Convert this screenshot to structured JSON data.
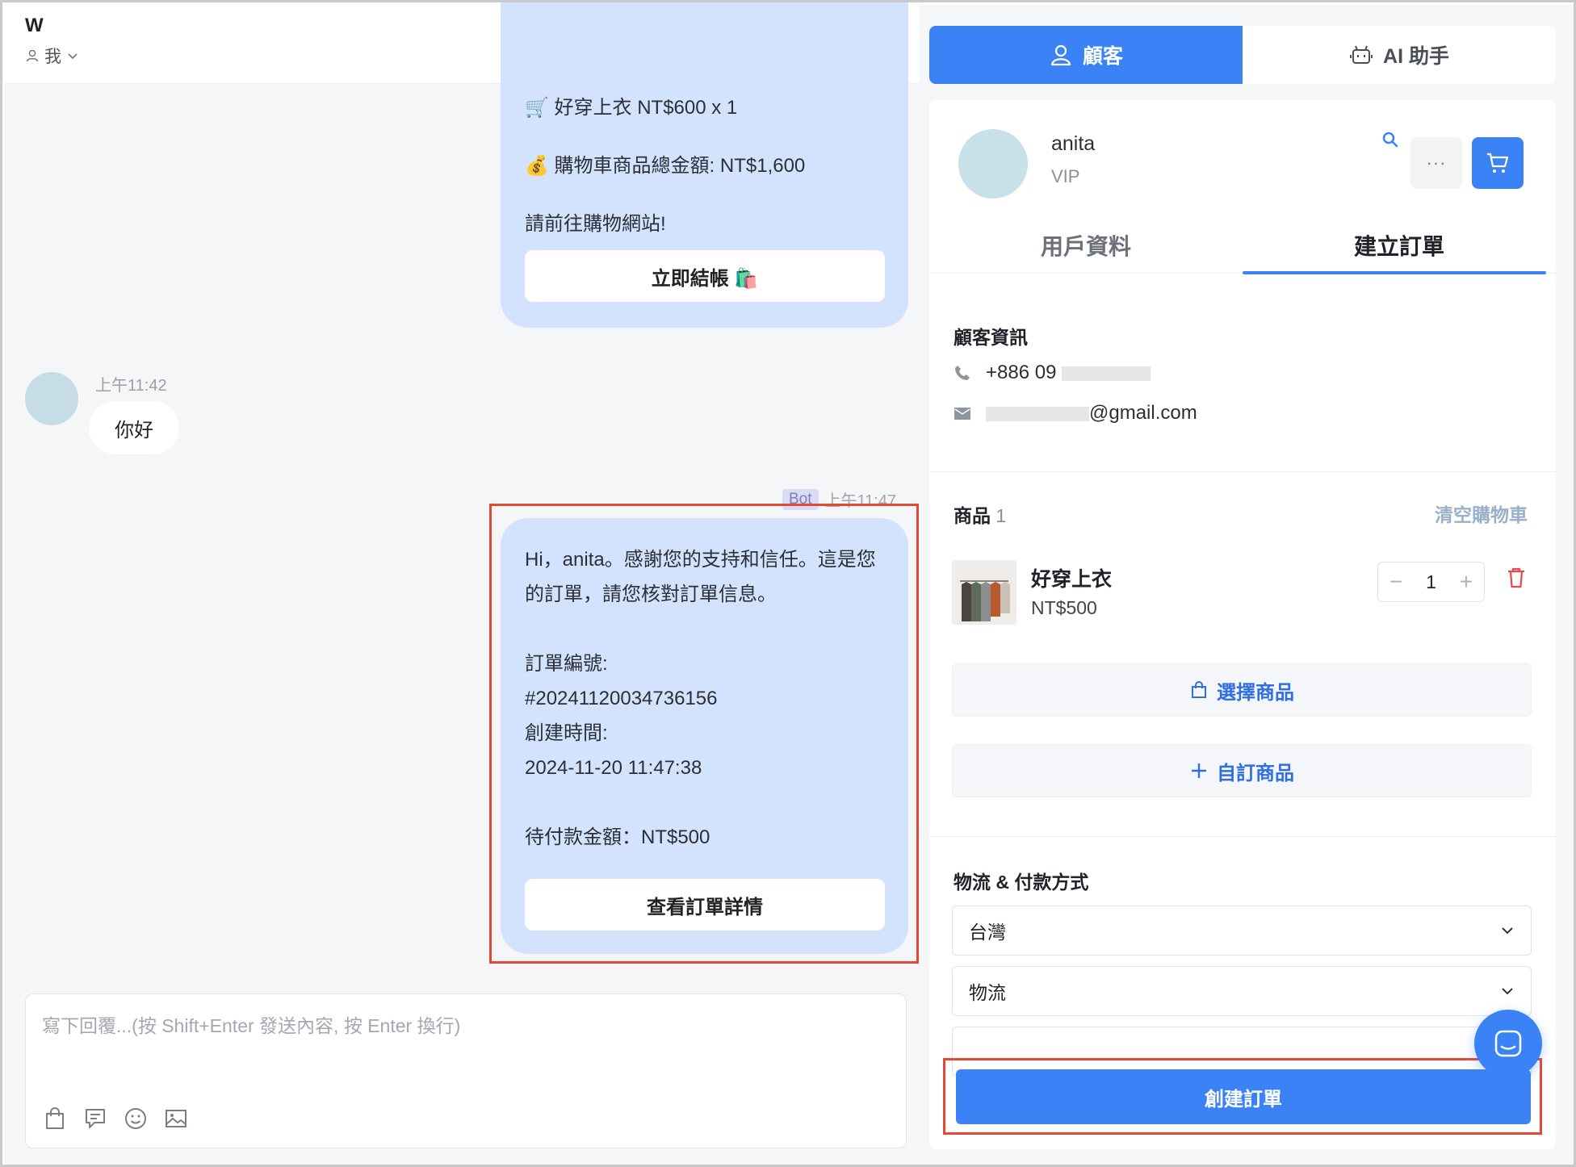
{
  "chat": {
    "title": "W",
    "agent": "我",
    "icons": [
      "star-icon",
      "message-square-icon",
      "clock-icon",
      "note-icon"
    ],
    "message1": {
      "lines": [
        "🛒 好穿上衣 NT$600 x 1",
        "💰 購物車商品總金額: NT$1,600",
        "請前往購物網站!"
      ],
      "button": "立即結帳 🛍️"
    },
    "user_message": {
      "time": "上午11:42",
      "text": "你好"
    },
    "bot_message": {
      "tag": "Bot",
      "time": "上午11:47",
      "text": "Hi，anita。感謝您的支持和信任。這是您的訂單，請您核對訂單信息。\n\n訂單編號:\n#20241120034736156\n創建時間:\n2024-11-20 11:47:38\n\n待付款金額：NT$500",
      "button": "查看訂單詳情"
    },
    "composer": {
      "placeholder": "寫下回覆...(按 Shift+Enter 發送內容, 按 Enter 換行)",
      "icons": [
        "shopping-bag-icon",
        "quick-reply-icon",
        "emoji-icon",
        "image-icon"
      ]
    }
  },
  "panel": {
    "tabs": [
      {
        "label": "顧客",
        "icon": "user-icon",
        "active": true
      },
      {
        "label": "AI 助手",
        "icon": "robot-icon",
        "active": false
      }
    ],
    "customer": {
      "name": "anita",
      "level": "VIP",
      "more_label": "···"
    },
    "sub_tabs": [
      {
        "label": "用戶資料",
        "active": false
      },
      {
        "label": "建立訂單",
        "active": true
      }
    ],
    "customer_info": {
      "title": "顧客資訊",
      "phone": "+886 09",
      "email": "@gmail.com"
    },
    "products": {
      "title": "商品",
      "count": "1",
      "clear_label": "清空購物車",
      "items": [
        {
          "name": "好穿上衣",
          "price": "NT$500",
          "quantity": "1"
        }
      ],
      "select_button": "選擇商品",
      "custom_button": "自訂商品"
    },
    "shipping": {
      "title": "物流 & 付款方式",
      "country": "台灣",
      "logistics": "物流"
    },
    "create_button": "創建訂單"
  },
  "colors": {
    "accent": "#3b82f6",
    "bot_bubble": "#d3e3fd",
    "highlight": "#e34a35",
    "danger": "#e5484d"
  }
}
